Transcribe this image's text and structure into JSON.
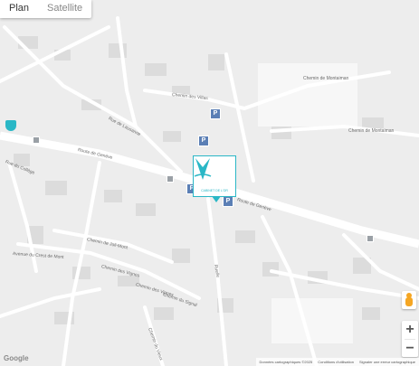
{
  "map_type": {
    "plan": "Plan",
    "satellite": "Satellite",
    "selected": "Plan"
  },
  "streets": [
    {
      "label": "Route de Genève"
    },
    {
      "label": "Route de Genève"
    },
    {
      "label": "Chemin de Montaiman"
    },
    {
      "label": "Chemin des Villas"
    },
    {
      "label": "Chemin de Montaiman"
    },
    {
      "label": "Rue de Lausanne"
    },
    {
      "label": "Rue du Collège"
    },
    {
      "label": "Chemin de Joli-Mont"
    },
    {
      "label": "Chemin des Vignes"
    },
    {
      "label": "Chemin du Signal"
    },
    {
      "label": "Avenue du Crest de Mont"
    },
    {
      "label": "Chemin des Vignes"
    },
    {
      "label": "Ruelle"
    },
    {
      "label": "Chemin du Vieux"
    }
  ],
  "marker": {
    "logo_color": "#2ab7c6",
    "caption": "CABINET DE L'OR"
  },
  "controls": {
    "zoom_in": "+",
    "zoom_out": "−"
  },
  "footer": {
    "logo": "Google",
    "data": "Données cartographiques ©2025",
    "terms": "Conditions d'utilisation",
    "report": "Signaler une erreur cartographique"
  },
  "colors": {
    "accent": "#2ab7c6",
    "parking": "#5b7fb5",
    "pegman": "#f5a623"
  }
}
